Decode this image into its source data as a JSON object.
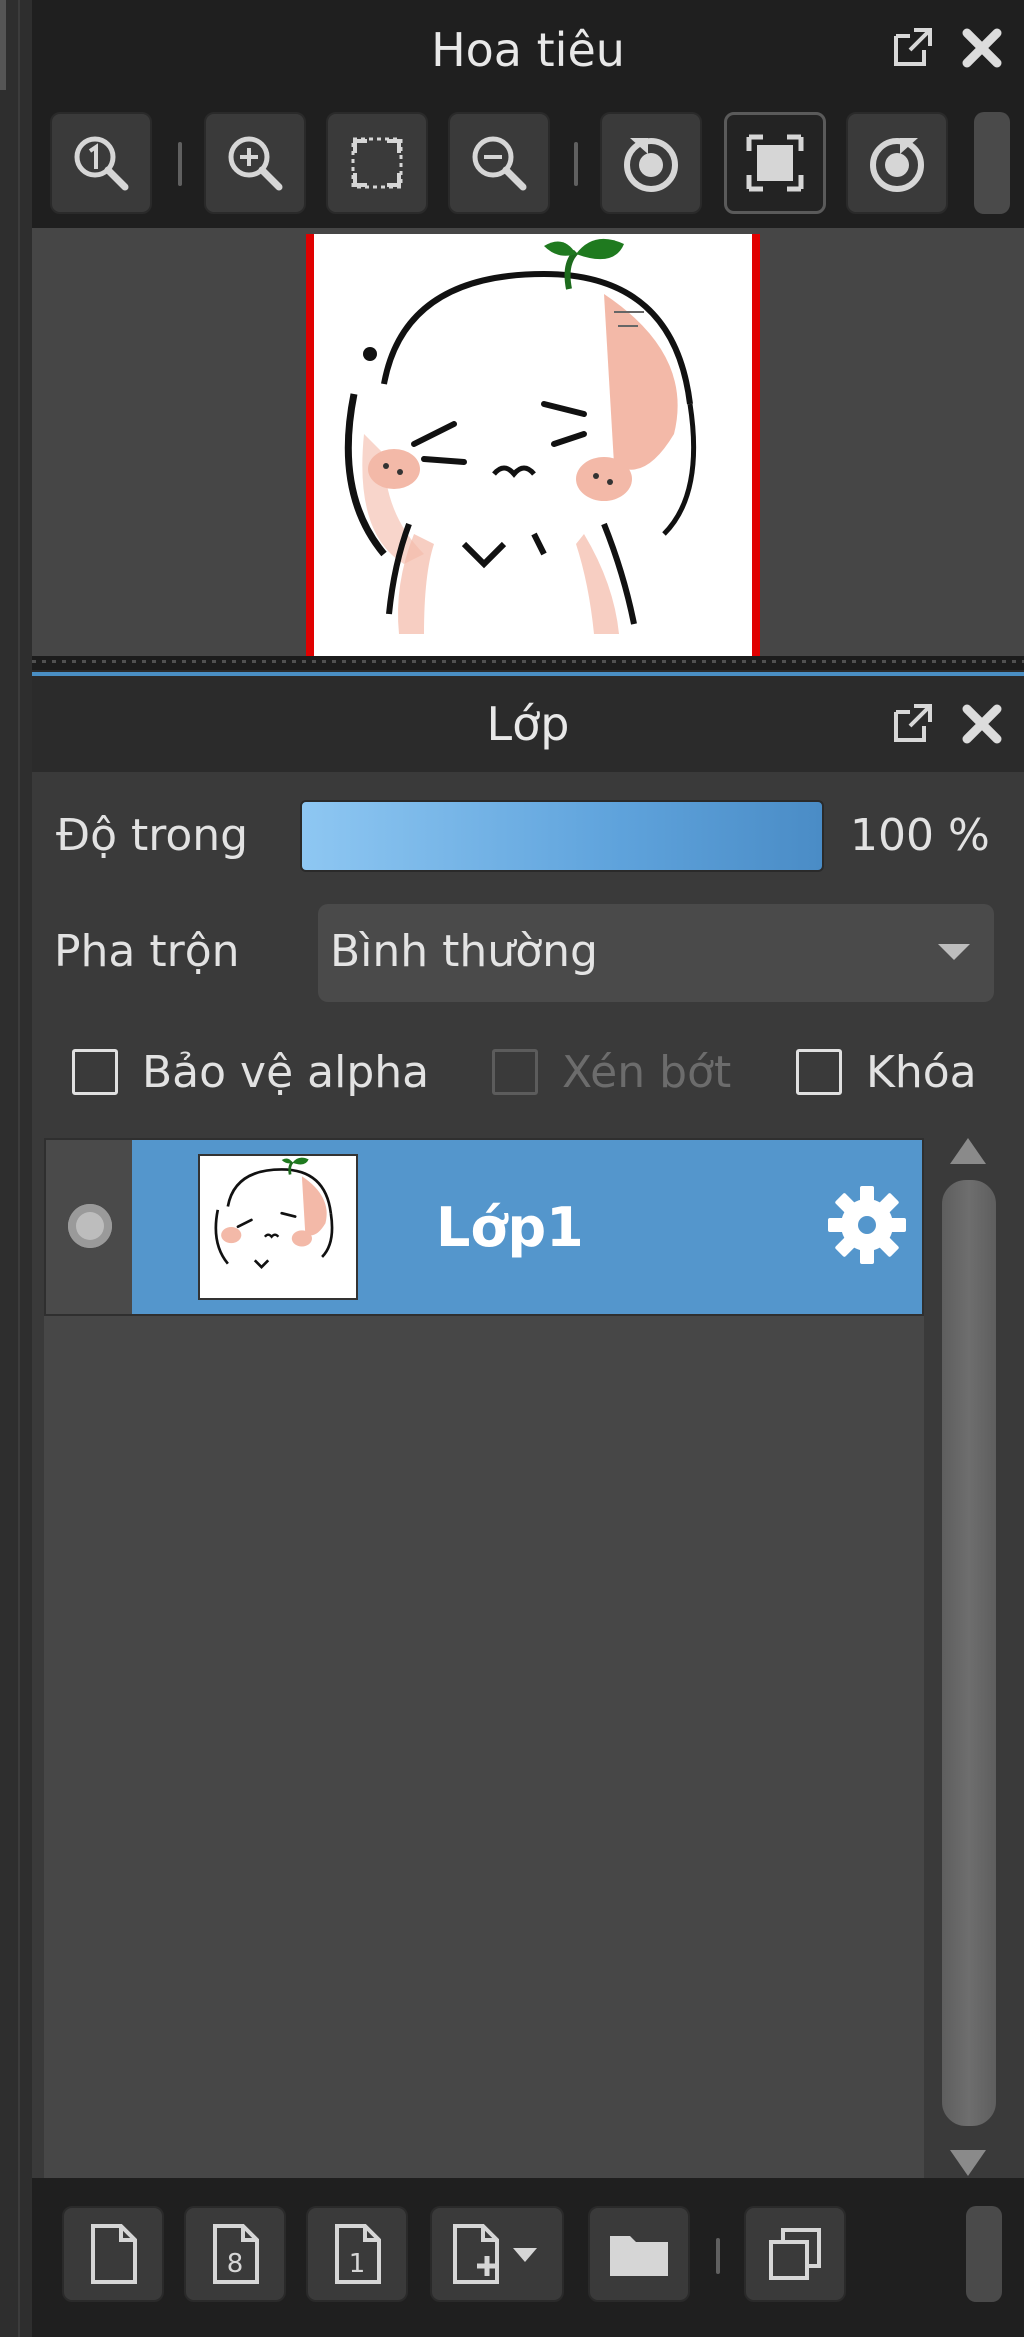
{
  "navigator": {
    "title": "Hoa tiêu",
    "toolbar": [
      {
        "icon": "zoom-actual-icon"
      },
      {
        "icon": "zoom-in-icon"
      },
      {
        "icon": "fit-screen-icon"
      },
      {
        "icon": "zoom-out-icon"
      },
      {
        "icon": "rotate-left-icon"
      },
      {
        "icon": "reset-view-icon",
        "active": true
      },
      {
        "icon": "rotate-right-icon"
      }
    ]
  },
  "layer_panel": {
    "title": "Lớp",
    "opacity": {
      "label": "Độ trong",
      "value_text": "100 %",
      "value": 100
    },
    "blend": {
      "label": "Pha trộn",
      "value": "Bình thường"
    },
    "checkboxes": [
      {
        "label": "Bảo vệ alpha",
        "checked": false,
        "enabled": true
      },
      {
        "label": "Xén bớt",
        "checked": false,
        "enabled": false
      },
      {
        "label": "Khóa",
        "checked": false,
        "enabled": true
      }
    ],
    "layers": [
      {
        "name": "Lớp1",
        "selected": true,
        "visible": true
      }
    ]
  },
  "colors": {
    "accent": "#5496cc",
    "panel_bg": "#3a3a3a",
    "canvas_border": "#e00000"
  }
}
